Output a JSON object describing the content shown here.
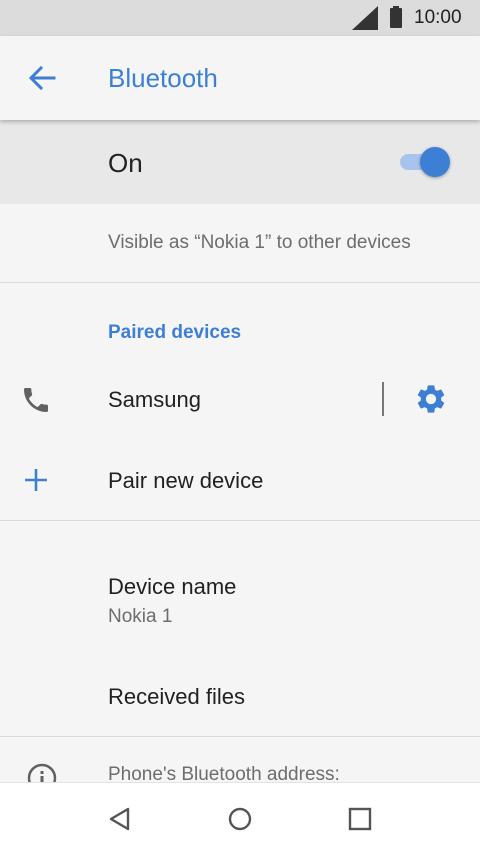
{
  "status_bar": {
    "time": "10:00",
    "icons": [
      "signal-icon",
      "battery-icon"
    ]
  },
  "app_bar": {
    "title": "Bluetooth",
    "back_icon": "arrow-back-icon"
  },
  "master_switch": {
    "label": "On",
    "checked": true
  },
  "visibility_text": "Visible as “Nokia 1” to other devices",
  "paired_section": {
    "header": "Paired devices",
    "devices": [
      {
        "name": "Samsung",
        "icon": "phone-icon",
        "settings_icon": "gear-icon"
      }
    ]
  },
  "pair_new": {
    "label": "Pair new device",
    "icon": "plus-icon"
  },
  "device_name": {
    "label": "Device name",
    "value": "Nokia 1"
  },
  "received_files": {
    "label": "Received files"
  },
  "bt_address": {
    "label": "Phone's Bluetooth address:",
    "icon": "info-icon"
  },
  "nav_bar": {
    "icons": [
      "back-nav-icon",
      "home-nav-icon",
      "recents-nav-icon"
    ]
  },
  "colors": {
    "accent": "#3e7fd6",
    "switch_track": "#a9c4ec",
    "status_bar": "#dcdcdc",
    "master_bg": "#e8e8e8"
  }
}
